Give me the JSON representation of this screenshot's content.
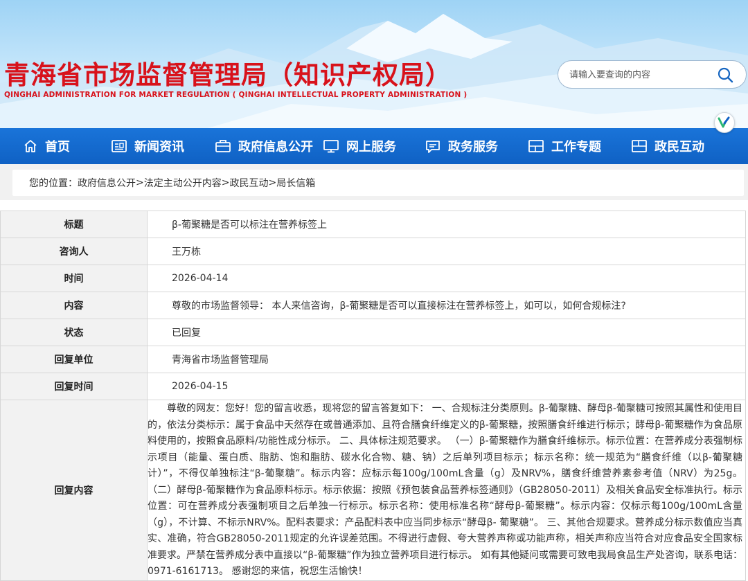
{
  "header": {
    "title": "青海省市场监督管理局（知识产权局）",
    "subtitle": "QINGHAI ADMINISTRATION FOR MARKET REGULATION ( QINGHAI INTELLECTUAL PROPERTY ADMINISTRATION )",
    "search": {
      "placeholder": "请输入要查询的内容"
    },
    "badge_icon": "accessibility-icon"
  },
  "nav": {
    "items": [
      {
        "label": "首页",
        "icon": "home-icon"
      },
      {
        "label": "新闻资讯",
        "icon": "news-icon"
      },
      {
        "label": "政府信息公开",
        "icon": "briefcase-icon"
      },
      {
        "label": "网上服务",
        "icon": "monitor-icon"
      },
      {
        "label": "政务服务",
        "icon": "chat-icon"
      },
      {
        "label": "工作专题",
        "icon": "layout-icon"
      },
      {
        "label": "政民互动",
        "icon": "interaction-icon"
      }
    ]
  },
  "breadcrumb": {
    "prefix": "您的位置：",
    "items": [
      "政府信息公开",
      "法定主动公开内容",
      "政民互动",
      "局长信箱"
    ],
    "separator": ">"
  },
  "details": {
    "title_label": "标题",
    "title_value": "β-葡聚糖是否可以标注在营养标签上",
    "asker_label": "咨询人",
    "asker_value": "王万栋",
    "time_label": "时间",
    "time_value": "2026-04-14",
    "content_label": "内容",
    "content_value": "尊敬的市场监督领导： 本人来信咨询，β-葡聚糖是否可以直接标注在营养标签上，如可以，如何合规标注?",
    "status_label": "状态",
    "status_value": "已回复",
    "reply_unit_label": "回复单位",
    "reply_unit_value": "青海省市场监督管理局",
    "reply_time_label": "回复时间",
    "reply_time_value": "2026-04-15",
    "reply_content_label": "回复内容",
    "reply_content_value": "尊敬的网友：您好！您的留言收悉，现将您的留言答复如下： 一、合规标注分类原则。β-葡聚糖、酵母β-葡聚糖可按照其属性和使用目的，依法分类标示：属于食品中天然存在或普通添加、且符合膳食纤维定义的β-葡聚糖，按照膳食纤维进行标示；酵母β-葡聚糖作为食品原料使用的，按照食品原料/功能性成分标示。 二、具体标注规范要求。 （一）β-葡聚糖作为膳食纤维标示。标示位置：在营养成分表强制标示项目（能量、蛋白质、脂肪、饱和脂肪、碳水化合物、糖、钠）之后单列项目标示；标示名称：统一规范为“膳食纤维（以β-葡聚糖计）”，不得仅单独标注“β-葡聚糖”。标示内容：应标示每100g/100mL含量（g）及NRV%，膳食纤维营养素参考值（NRV）为25g。 （二）酵母β-葡聚糖作为食品原料标示。标示依据：按照《预包装食品营养标签通则》（GB28050-2011）及相关食品安全标准执行。标示位置：可在营养成分表强制项目之后单独一行标示。标示名称：使用标准名称“酵母β-葡聚糖”。标示内容：仅标示每100g/100mL含量（g），不计算、不标示NRV%。配料表要求：产品配料表中应当同步标示“酵母β- 葡聚糖”。 三、其他合规要求。营养成分标示数值应当真实、准确，符合GB28050-2011规定的允许误差范围。不得进行虚假、夸大营养声称或功能声称，相关声称应当符合对应食品安全国家标准要求。严禁在营养成分表中直接以“β-葡聚糖”作为独立营养项目进行标示。 如有其他疑问或需要可致电我局食品生产处咨询，联系电话：0971-6161713。 感谢您的来信，祝您生活愉快！"
  },
  "colors": {
    "title_red": "#d8121b",
    "nav_blue": "#1a74d9",
    "label_bg": "#f2f2f2"
  }
}
